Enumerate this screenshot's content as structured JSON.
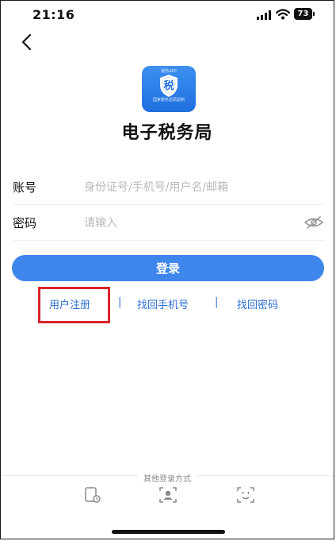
{
  "status_bar": {
    "time": "21:16",
    "battery": "73"
  },
  "app": {
    "logo_top_text": "税务APP",
    "logo_char": "税",
    "logo_bottom_text": "国家税务总局监制",
    "title": "电子税务局",
    "brand_color": "#3f86ec"
  },
  "form": {
    "account_label": "账号",
    "account_placeholder": "身份证号/手机号/用户名/邮箱",
    "account_value": "",
    "password_label": "密码",
    "password_placeholder": "请输入",
    "password_value": ""
  },
  "login_button": "登录",
  "links": {
    "register": "用户注册",
    "separator": "|",
    "find_phone": "找回手机号",
    "find_password": "找回密码",
    "highlight_color": "#d7252a"
  },
  "other_login": {
    "label": "其他登录方式",
    "methods": [
      "device-login-icon",
      "face-login-icon",
      "face-scan-icon"
    ]
  }
}
